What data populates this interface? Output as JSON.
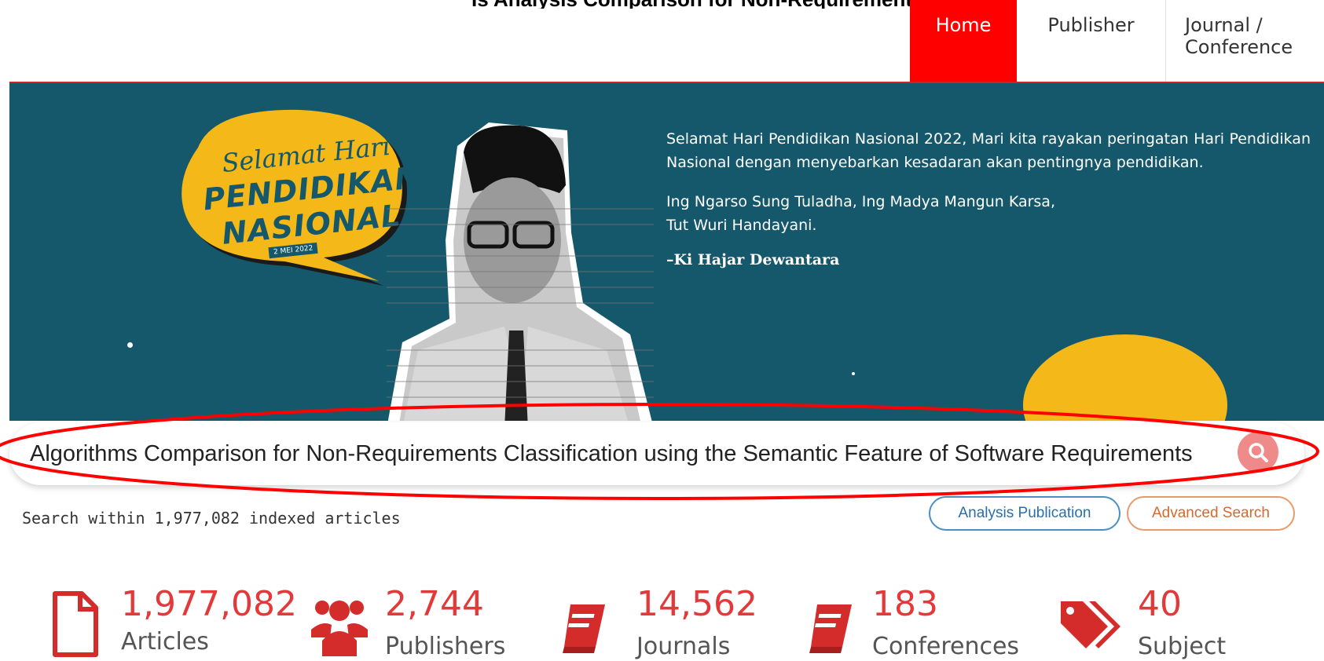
{
  "header": {
    "caption": "Is Analysis Comparison for Non-Requirements Classification using the Semantic Feature of Software Requirement",
    "nav": [
      "Home",
      "Publisher",
      "Journal / Conference"
    ]
  },
  "banner": {
    "bubble_line1": "Selamat Hari",
    "bubble_line2": "PENDIDIKAN",
    "bubble_line3": "NASIONAL",
    "bubble_date": "2 MEI 2022",
    "quote_p1": "Selamat Hari Pendidikan Nasional 2022, Mari kita rayakan peringatan Hari Pendidikan Nasional dengan menyebarkan kesadaran akan pentingnya pendidikan.",
    "quote_p2a": "Ing Ngarso Sung Tuladha, Ing Madya Mangun Karsa,",
    "quote_p2b": "Tut Wuri Handayani.",
    "quote_attrib": "–Ki Hajar Dewantara"
  },
  "search": {
    "value": "Algorithms Comparison for Non-Requirements Classification using the Semantic Feature of Software Requirements",
    "note": "Search within 1,977,082 indexed articles"
  },
  "buttons": {
    "analysis": "Analysis Publication",
    "advanced": "Advanced Search"
  },
  "stats": [
    {
      "value": "1,977,082",
      "label": "Articles",
      "icon": "document-icon"
    },
    {
      "value": "2,744",
      "label": "Publishers",
      "icon": "users-icon"
    },
    {
      "value": "14,562",
      "label": "Journals",
      "icon": "book-icon"
    },
    {
      "value": "183",
      "label": "Conferences",
      "icon": "book-icon"
    },
    {
      "value": "40",
      "label": "Subject",
      "icon": "tags-icon"
    }
  ],
  "colors": {
    "accent": "#ff0000",
    "banner_bg": "#15586b",
    "stat_number": "#e23a3a",
    "annotation": "#ff0000"
  }
}
